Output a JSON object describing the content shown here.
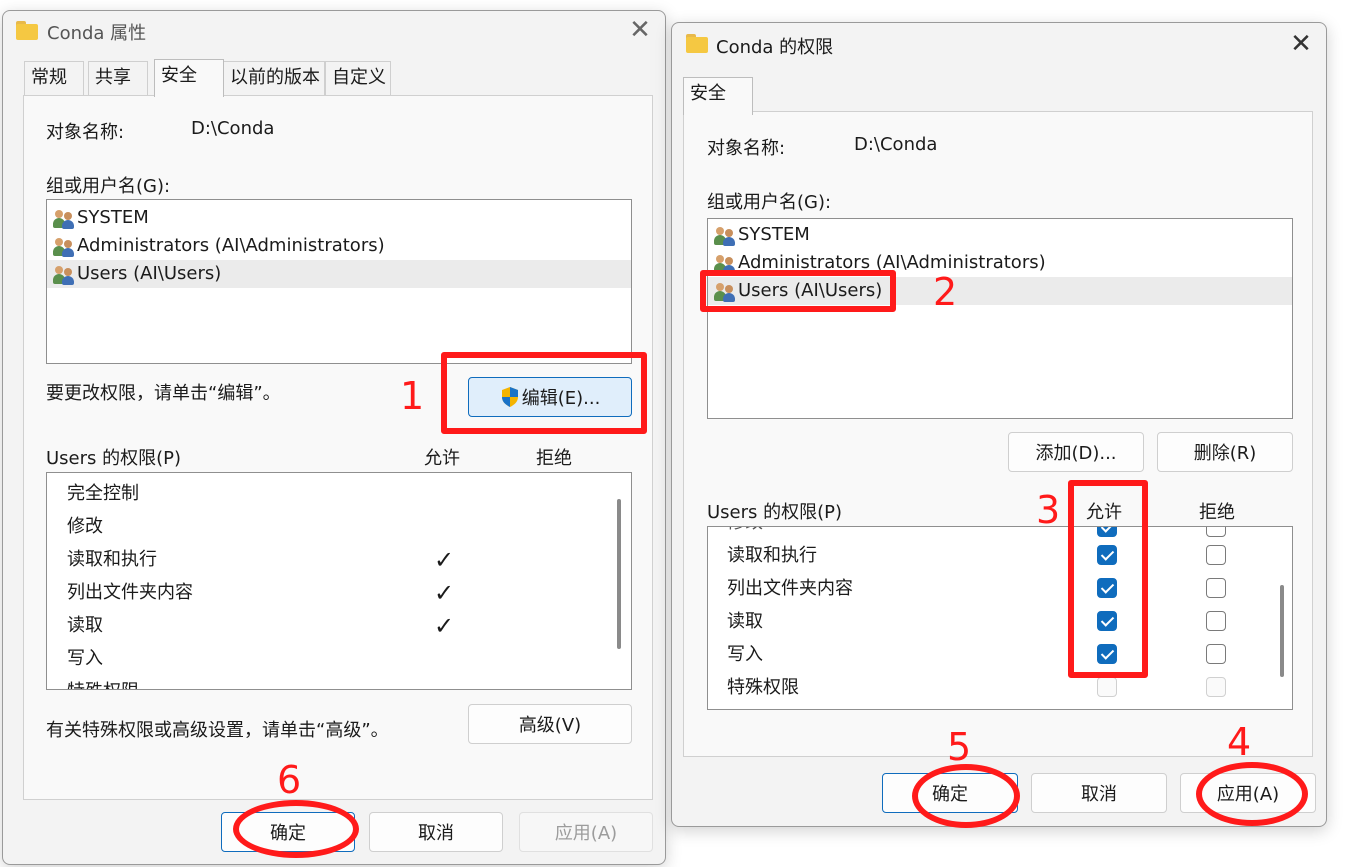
{
  "window1": {
    "title": "Conda 属性",
    "tabs": [
      {
        "label": "常规"
      },
      {
        "label": "共享"
      },
      {
        "label": "安全"
      },
      {
        "label": "以前的版本"
      },
      {
        "label": "自定义"
      }
    ],
    "object_label": "对象名称:",
    "object_value": "D:\\Conda",
    "group_label": "组或用户名(G):",
    "users": [
      {
        "name": "SYSTEM"
      },
      {
        "name": "Administrators (AI\\Administrators)"
      },
      {
        "name": "Users (AI\\Users)"
      }
    ],
    "edit_hint": "要更改权限，请单击“编辑”。",
    "edit_button": "编辑(E)...",
    "perm_label": "Users 的权限(P)",
    "allow_header": "允许",
    "deny_header": "拒绝",
    "permissions": [
      {
        "name": "完全控制",
        "allow": false
      },
      {
        "name": "修改",
        "allow": false
      },
      {
        "name": "读取和执行",
        "allow": true
      },
      {
        "name": "列出文件夹内容",
        "allow": true
      },
      {
        "name": "读取",
        "allow": true
      },
      {
        "name": "写入",
        "allow": false
      },
      {
        "name": "特殊权限",
        "allow": false
      }
    ],
    "advanced_hint": "有关特殊权限或高级设置，请单击“高级”。",
    "advanced_button": "高级(V)",
    "ok_button": "确定",
    "cancel_button": "取消",
    "apply_button": "应用(A)"
  },
  "window2": {
    "title": "Conda 的权限",
    "tab": "安全",
    "object_label": "对象名称:",
    "object_value": "D:\\Conda",
    "group_label": "组或用户名(G):",
    "users": [
      {
        "name": "SYSTEM"
      },
      {
        "name": "Administrators (AI\\Administrators)"
      },
      {
        "name": "Users (AI\\Users)"
      }
    ],
    "add_button": "添加(D)...",
    "remove_button": "删除(R)",
    "perm_label": "Users 的权限(P)",
    "allow_header": "允许",
    "deny_header": "拒绝",
    "permissions": [
      {
        "name": "修改",
        "allow": true,
        "deny": false
      },
      {
        "name": "读取和执行",
        "allow": true,
        "deny": false
      },
      {
        "name": "列出文件夹内容",
        "allow": true,
        "deny": false
      },
      {
        "name": "读取",
        "allow": true,
        "deny": false
      },
      {
        "name": "写入",
        "allow": true,
        "deny": false
      },
      {
        "name": "特殊权限",
        "allow": false,
        "deny": false
      }
    ],
    "ok_button": "确定",
    "cancel_button": "取消",
    "apply_button": "应用(A)"
  },
  "annotations": {
    "step1": "1",
    "step2": "2",
    "step3": "3",
    "step4": "4",
    "step5": "5",
    "step6": "6",
    "color": "#ff1a1a"
  }
}
